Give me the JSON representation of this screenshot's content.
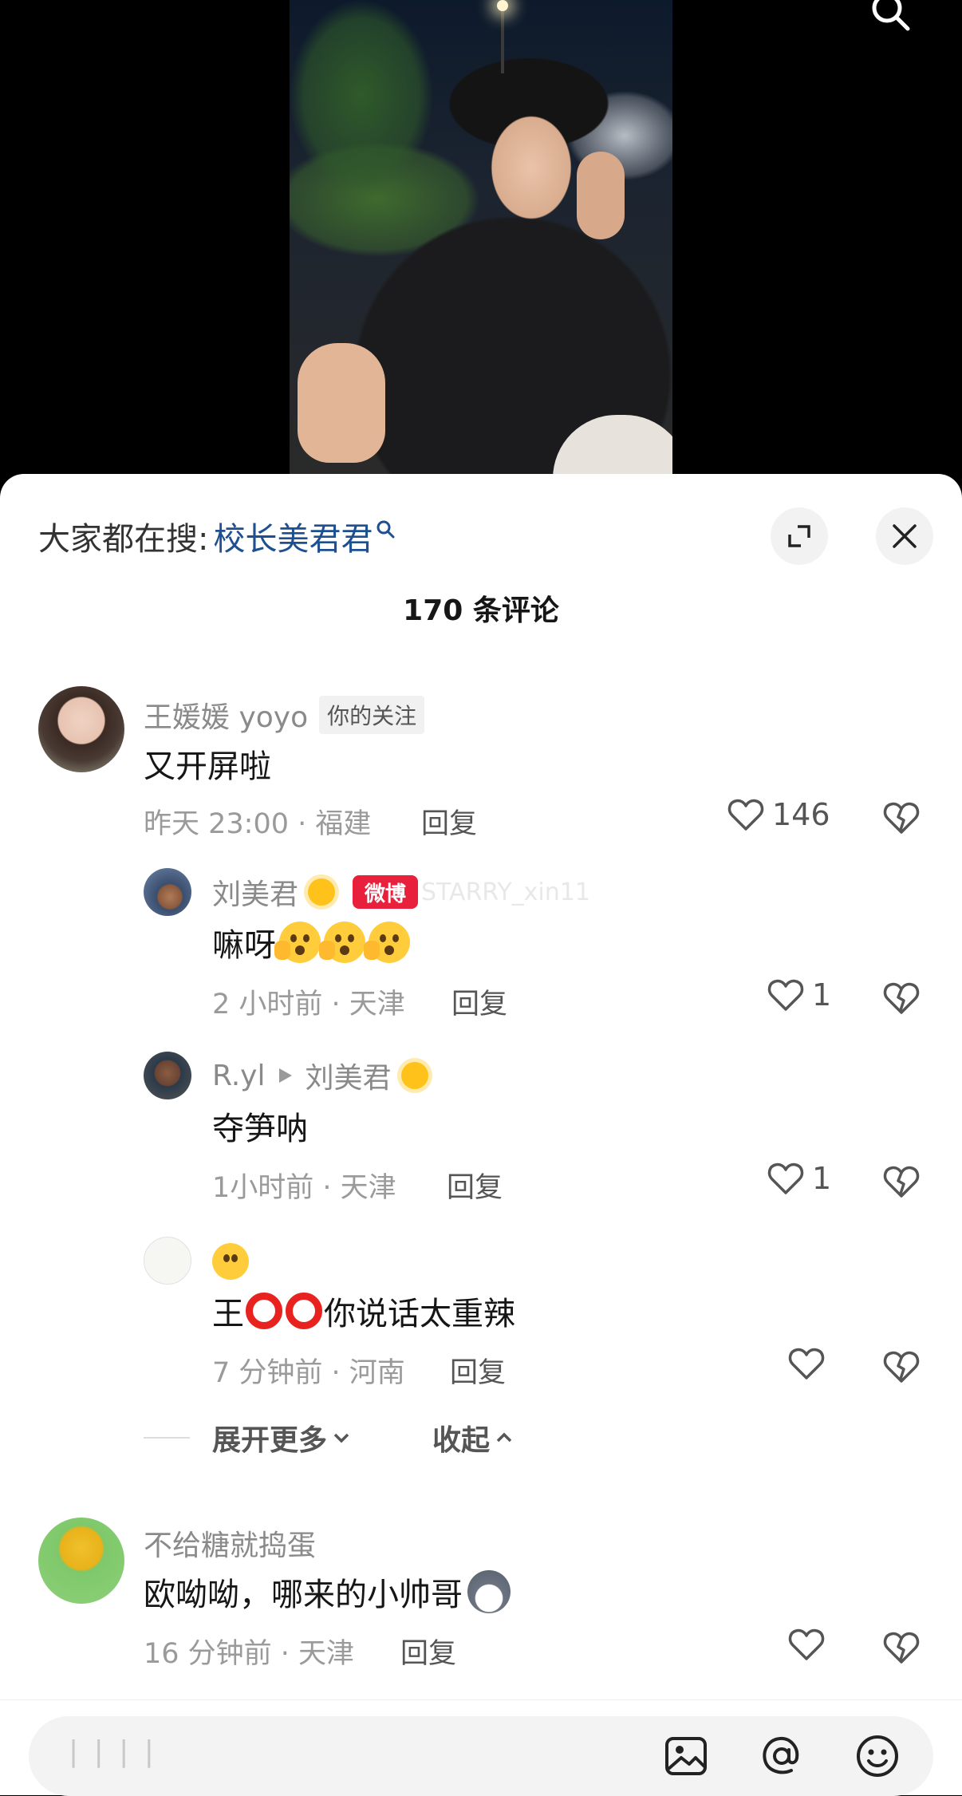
{
  "header": {
    "hot_search_prefix": "大家都在搜:",
    "hot_search_keyword": "校长美君君",
    "comment_count_title": "170 条评论"
  },
  "comments": [
    {
      "user": "王媛媛 yoyo",
      "badge": "你的关注",
      "text": "又开屏啦",
      "time_location": "昨天 23:00 · 福建",
      "reply_label": "回复",
      "likes": "146"
    },
    {
      "user": "刘美君",
      "weibo_badge": "微博",
      "weibo_handle": "STARRY_xin11",
      "text": "嘛呀",
      "time_location": "2 小时前 · 天津",
      "reply_label": "回复",
      "likes": "1"
    },
    {
      "user": "R.yl",
      "reply_to": "刘美君",
      "text": "夺笋呐",
      "time_location": "1小时前 · 天津",
      "reply_label": "回复",
      "likes": "1"
    },
    {
      "user": "",
      "text_prefix": "王",
      "text_suffix": "你说话太重辣",
      "time_location": "7 分钟前 · 河南",
      "reply_label": "回复",
      "likes": ""
    },
    {
      "user": "不给糖就捣蛋",
      "text": "欧呦呦，哪来的小帅哥",
      "time_location": "16 分钟前 · 天津",
      "reply_label": "回复",
      "likes": ""
    }
  ],
  "thread_controls": {
    "expand_more": "展开更多",
    "collapse": "收起"
  },
  "input_bar": {
    "placeholder": "| |  | |"
  },
  "icons": [
    "search-icon",
    "expand-icon",
    "close-icon",
    "heart-icon",
    "dislike-icon",
    "image-icon",
    "at-icon",
    "emoji-icon"
  ],
  "colors": {
    "keyword": "#1d4f91",
    "weibo_red": "#e9203b",
    "sheet_bg": "#ffffff"
  }
}
